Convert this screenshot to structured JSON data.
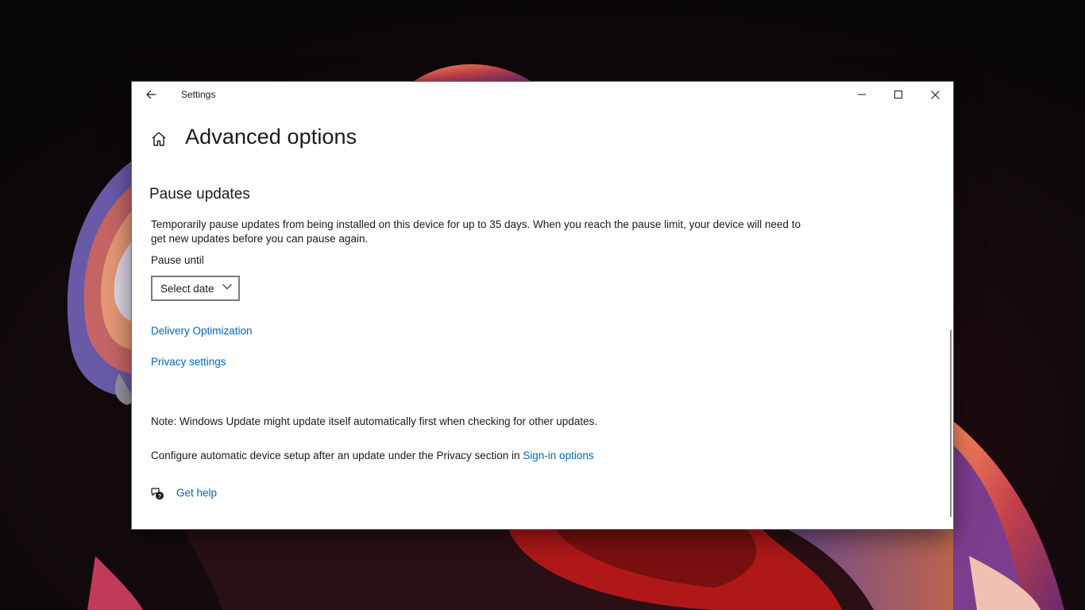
{
  "window": {
    "title": "Settings"
  },
  "page": {
    "title": "Advanced options"
  },
  "pause_updates": {
    "heading": "Pause updates",
    "description": "Temporarily pause updates from being installed on this device for up to 35 days. When you reach the pause limit, your device will need to get new updates before you can pause again.",
    "pause_until_label": "Pause until",
    "select_value": "Select date"
  },
  "links": {
    "delivery_optimization": "Delivery Optimization",
    "privacy_settings": "Privacy settings"
  },
  "note": "Note: Windows Update might update itself automatically first when checking for other updates.",
  "config": {
    "text": "Configure automatic device setup after an update under the Privacy section in ",
    "link": "Sign-in options"
  },
  "help": {
    "label": "Get help"
  },
  "colors": {
    "accent": "#0067b8",
    "text": "#1a1a1a",
    "window_bg": "#ffffff"
  },
  "icons": {
    "back": "back-arrow-icon",
    "minimize": "minimize-icon",
    "maximize": "maximize-icon",
    "close": "close-icon",
    "home": "home-icon",
    "select_chevron": "chevron-down-icon",
    "help": "help-chat-icon"
  }
}
